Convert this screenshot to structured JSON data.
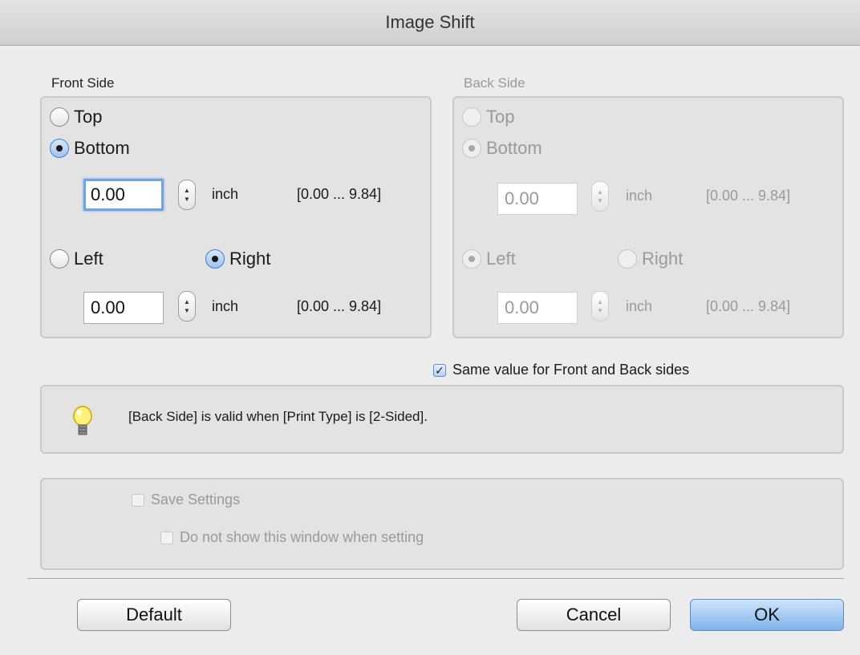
{
  "window": {
    "title": "Image Shift"
  },
  "front": {
    "label": "Front Side",
    "top_label": "Top",
    "bottom_label": "Bottom",
    "vertical_value": "0.00",
    "left_label": "Left",
    "right_label": "Right",
    "horizontal_value": "0.00",
    "unit": "inch",
    "range": "[0.00 ... 9.84]",
    "vertical_selected": "Bottom",
    "horizontal_selected": "Right"
  },
  "back": {
    "label": "Back Side",
    "top_label": "Top",
    "bottom_label": "Bottom",
    "vertical_value": "0.00",
    "left_label": "Left",
    "right_label": "Right",
    "horizontal_value": "0.00",
    "unit": "inch",
    "range": "[0.00 ... 9.84]",
    "enabled": false
  },
  "same_value": {
    "label": "Same value for Front and Back sides",
    "checked": true
  },
  "info": {
    "message": "[Back Side] is valid when [Print Type] is [2-Sided].",
    "icon": "lightbulb-icon"
  },
  "settings": {
    "save_label": "Save Settings",
    "save_checked": false,
    "no_show_label": "Do not show this window when setting",
    "no_show_checked": false
  },
  "buttons": {
    "default": "Default",
    "cancel": "Cancel",
    "ok": "OK"
  },
  "colors": {
    "accent": "#3b7fd6",
    "ok_button": "#7fb3ea",
    "panel": "#e3e3e3"
  }
}
